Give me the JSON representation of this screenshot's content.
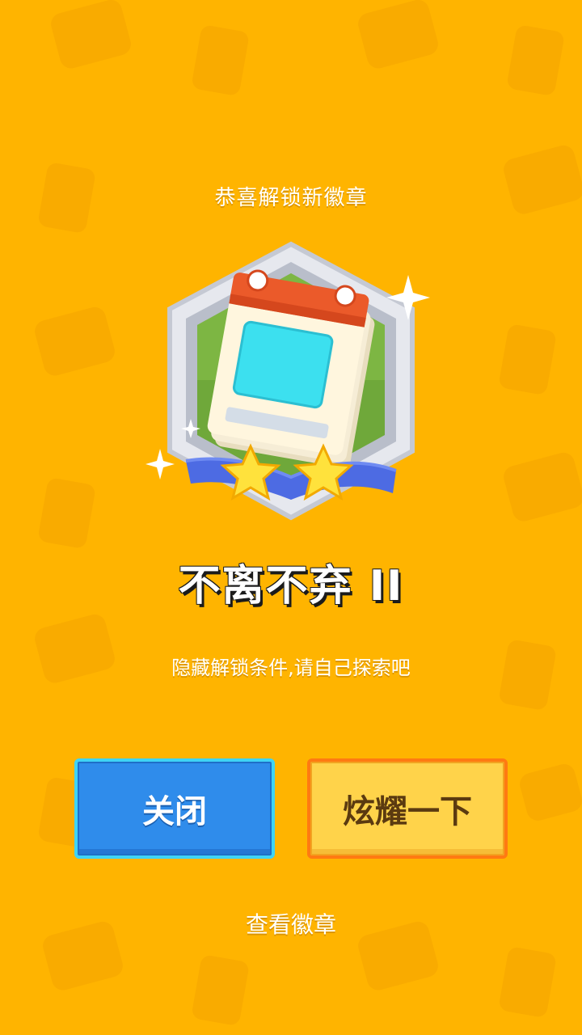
{
  "header": {
    "title": "恭喜解锁新徽章"
  },
  "badge": {
    "icon": "calendar-badge-icon",
    "name": "不离不弃 II",
    "stars": 2,
    "hint": "隐藏解锁条件,请自己探索吧"
  },
  "actions": {
    "close_label": "关闭",
    "share_label": "炫耀一下",
    "view_badges_label": "查看徽章"
  },
  "colors": {
    "background": "#FFB400",
    "close_button": "#2F8CEB",
    "share_button": "#FFD34A"
  }
}
